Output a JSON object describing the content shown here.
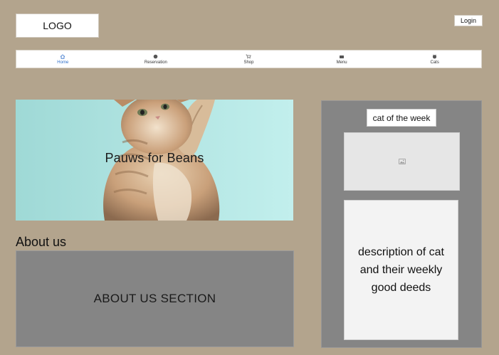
{
  "header": {
    "logo_text": "LOGO",
    "login_label": "Login"
  },
  "nav": {
    "items": [
      {
        "label": "Home",
        "icon": "home-icon",
        "active": true
      },
      {
        "label": "Reservation",
        "icon": "reservation-icon",
        "active": false
      },
      {
        "label": "Shop",
        "icon": "cart-icon",
        "active": false
      },
      {
        "label": "Menu",
        "icon": "menu-icon",
        "active": false
      },
      {
        "label": "Cats",
        "icon": "cat-icon",
        "active": false
      }
    ]
  },
  "hero": {
    "title": "Pauws for Beans",
    "image": "kitten-photo"
  },
  "about": {
    "heading": "About us",
    "section_text": "ABOUT US SECTION"
  },
  "cat_of_week": {
    "label": "cat of the week",
    "image_placeholder_icon": "image-icon",
    "description": "description of cat and their weekly good deeds"
  },
  "colors": {
    "background": "#b3a48d",
    "panel_gray": "#858585",
    "active_nav": "#2f6fc9",
    "hero_bg": "#b7ebea"
  }
}
